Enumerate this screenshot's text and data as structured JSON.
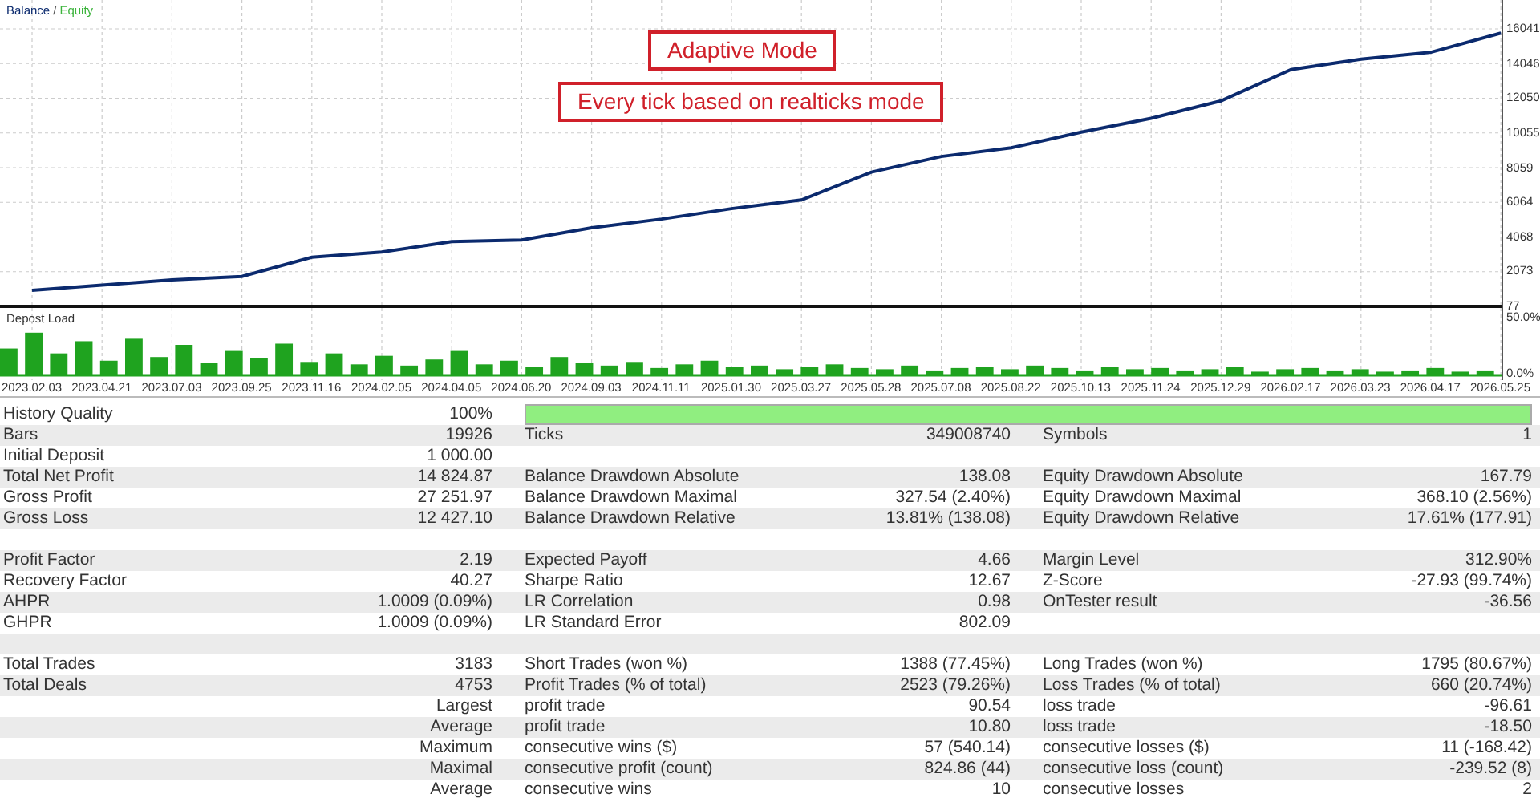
{
  "balance_chart": {
    "legend": [
      {
        "label": "Equity",
        "color": "#3cb43c"
      }
    ],
    "legend_separator": "/",
    "chart_data": {
      "type": "line",
      "x": [
        "2023.02.03",
        "2023.04.21",
        "2023.07.03",
        "2023.09.25",
        "2023.11.16",
        "2024.02.05",
        "2024.04.05",
        "2024.06.20",
        "2024.09.03",
        "2024.11.11",
        "2025.01.30",
        "2025.03.27",
        "2025.05.28",
        "2025.07.08",
        "2025.08.22",
        "2025.10.13",
        "2025.11.24",
        "2025.12.29",
        "2026.02.17",
        "2026.03.23",
        "2026.04.17",
        "2026.05.25"
      ],
      "series": [
        {
          "name": "Balance",
          "color": "#0b2a6e",
          "values": [
            1000,
            1300,
            1600,
            1800,
            2900,
            3200,
            3800,
            3900,
            4600,
            5100,
            5700,
            6200,
            7800,
            8700,
            9200,
            10100,
            10900,
            11900,
            13700,
            14300,
            14700,
            15800
          ]
        }
      ],
      "grid": true,
      "yticks": [
        {
          "value": 77,
          "label": "77"
        },
        {
          "value": 2073,
          "label": "2073"
        },
        {
          "value": 4068,
          "label": "4068"
        },
        {
          "value": 6064,
          "label": "6064"
        },
        {
          "value": 8059,
          "label": "8059"
        },
        {
          "value": 10055,
          "label": "10055"
        },
        {
          "value": 12050,
          "label": "12050"
        },
        {
          "value": 14046,
          "label": "14046"
        },
        {
          "value": 16041,
          "label": "16041"
        }
      ],
      "ylim": [
        77,
        16041
      ]
    }
  },
  "deposit_load": {
    "chart_data": {
      "type": "bar",
      "series": [
        {
          "name": "Depost Load",
          "color": "#1fa31f",
          "values": [
            22,
            35,
            18,
            28,
            12,
            30,
            15,
            25,
            10,
            20,
            14,
            26,
            11,
            18,
            9,
            16,
            8,
            13,
            20,
            9,
            12,
            7,
            15,
            10,
            8,
            11,
            6,
            9,
            12,
            7,
            8,
            5,
            7,
            9,
            6,
            5,
            8,
            4,
            6,
            7,
            5,
            8,
            6,
            4,
            7,
            5,
            6,
            4,
            5,
            7,
            3,
            5,
            6,
            4,
            5,
            3,
            4,
            6,
            3,
            4
          ]
        }
      ],
      "yticks": [
        {
          "value": 0,
          "label": "0.0%"
        },
        {
          "value": 50,
          "label": "50.0%"
        }
      ],
      "ylim": [
        0,
        50
      ],
      "grid": true
    }
  },
  "annotations": [
    {
      "text": "Adaptive Mode"
    },
    {
      "text": "Every tick based on realticks mode"
    }
  ],
  "stats": [
    {
      "kind": "quality",
      "label": "History Quality",
      "value": "100%",
      "level": 1
    },
    {
      "kind": "stat",
      "label": "Bars",
      "value": "19926",
      "label_2": "Ticks",
      "value_2": "349008740",
      "label_3": "Symbols",
      "value_3": "1"
    },
    {
      "kind": "stat",
      "label": "Initial Deposit",
      "value": "1 000.00"
    },
    {
      "kind": "stat",
      "label": "Total Net Profit",
      "value": "14 824.87",
      "label_2": "Balance Drawdown Absolute",
      "value_2": "138.08",
      "label_3": "Equity Drawdown Absolute",
      "value_3": "167.79"
    },
    {
      "kind": "stat",
      "label": "Gross Profit",
      "value": "27 251.97",
      "label_2": "Balance Drawdown Maximal",
      "value_2": "327.54 (2.40%)",
      "label_3": "Equity Drawdown Maximal",
      "value_3": "368.10 (2.56%)"
    },
    {
      "kind": "stat",
      "label": "Gross Loss",
      "value": "12 427.10",
      "label_2": "Balance Drawdown Relative",
      "value_2": "13.81% (138.08)",
      "label_3": "Equity Drawdown Relative",
      "value_3": "17.61% (177.91)"
    },
    {
      "kind": "spacer"
    },
    {
      "kind": "stat",
      "label": "Profit Factor",
      "value": "2.19",
      "label_2": "Expected Payoff",
      "value_2": "4.66",
      "label_3": "Margin Level",
      "value_3": "312.90%"
    },
    {
      "kind": "stat",
      "label": "Recovery Factor",
      "value": "40.27",
      "label_2": "Sharpe Ratio",
      "value_2": "12.67",
      "label_3": "Z-Score",
      "value_3": "-27.93 (99.74%)"
    },
    {
      "kind": "stat",
      "label": "AHPR",
      "value": "1.0009 (0.09%)",
      "label_2": "LR Correlation",
      "value_2": "0.98",
      "label_3": "OnTester result",
      "value_3": "-36.56"
    },
    {
      "kind": "stat",
      "label": "GHPR",
      "value": "1.0009 (0.09%)",
      "label_2": "LR Standard Error",
      "value_2": "802.09"
    },
    {
      "kind": "spacer"
    },
    {
      "kind": "stat",
      "label": "Total Trades",
      "value": "3183",
      "label_2": "Short Trades (won %)",
      "value_2": "1388 (77.45%)",
      "label_3": "Long Trades (won %)",
      "value_3": "1795 (80.67%)"
    },
    {
      "kind": "stat",
      "label": "Total Deals",
      "value": "4753",
      "label_2": "Profit Trades (% of total)",
      "value_2": "2523 (79.26%)",
      "label_3": "Loss Trades (% of total)",
      "value_3": "660 (20.74%)"
    },
    {
      "kind": "stat",
      "sublabel": "Largest",
      "label_2": "profit trade",
      "value_2": "90.54",
      "label_3": "loss trade",
      "value_3": "-96.61"
    },
    {
      "kind": "stat",
      "sublabel": "Average",
      "label_2": "profit trade",
      "value_2": "10.80",
      "label_3": "loss trade",
      "value_3": "-18.50"
    },
    {
      "kind": "stat",
      "sublabel": "Maximum",
      "label_2": "consecutive wins ($)",
      "value_2": "57 (540.14)",
      "label_3": "consecutive losses ($)",
      "value_3": "11 (-168.42)"
    },
    {
      "kind": "stat",
      "sublabel": "Maximal",
      "label_2": "consecutive profit (count)",
      "value_2": "824.86 (44)",
      "label_3": "consecutive loss (count)",
      "value_3": "-239.52 (8)"
    },
    {
      "kind": "stat",
      "sublabel": "Average",
      "label_2": "consecutive wins",
      "value_2": "10",
      "label_3": "consecutive losses",
      "value_3": "2"
    }
  ]
}
